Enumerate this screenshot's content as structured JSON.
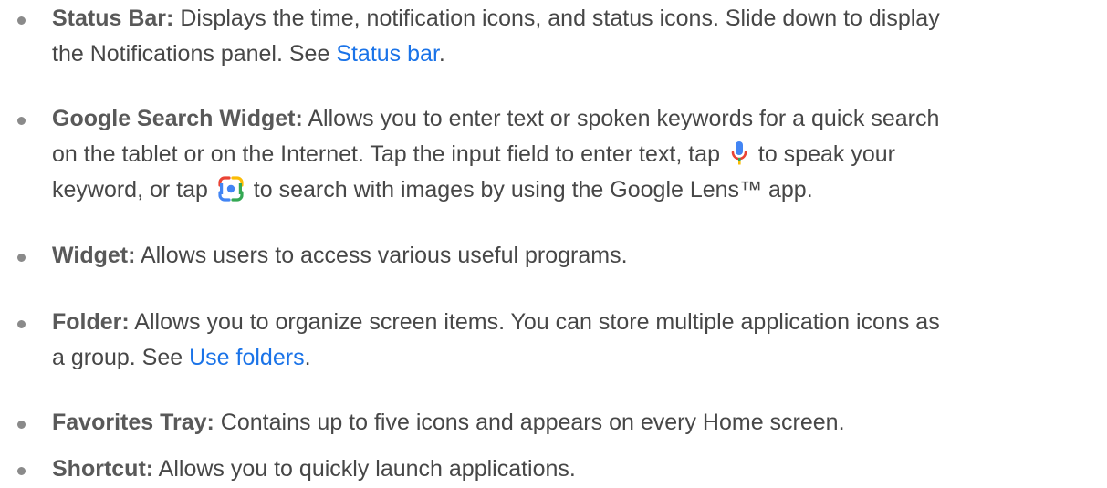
{
  "items": [
    {
      "term": "Status Bar:",
      "line1": " Displays the time, notification icons, and status icons. Slide down to display",
      "line2_pre": "the Notifications panel. See ",
      "link": "Status bar",
      "line2_post": "."
    },
    {
      "term": "Google Search Widget:",
      "line1": " Allows you to enter text or spoken keywords for a quick search",
      "line2_pre": "on the tablet or on the Internet. Tap the input field to enter text, tap ",
      "line2_post": " to speak your",
      "line3_pre": "keyword, or tap ",
      "line3_post": " to search with images by using the Google Lens™ app.",
      "icons": [
        "microphone-icon",
        "google-lens-icon"
      ]
    },
    {
      "term": "Widget:",
      "line1": " Allows users to access various useful programs."
    },
    {
      "term": "Folder:",
      "line1": " Allows you to organize screen items. You can store multiple application icons as",
      "line2_pre": "a group. See ",
      "link": "Use folders",
      "line2_post": "."
    },
    {
      "term": "Favorites Tray:",
      "line1": " Contains up to five icons and appears on every Home screen."
    },
    {
      "term": "Shortcut:",
      "line1": " Allows you to quickly launch applications."
    }
  ],
  "colors": {
    "link": "#1a73e8",
    "text": "#474747",
    "bullet": "#8a8a8a"
  }
}
